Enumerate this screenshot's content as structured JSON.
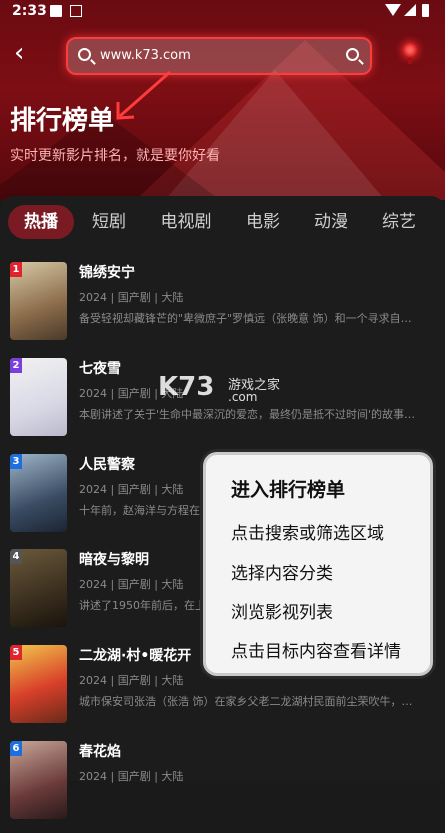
{
  "status_bar": {
    "time": "2:33"
  },
  "search": {
    "url": "www.k73.com"
  },
  "header": {
    "title": "排行榜单",
    "subtitle": "实时更新影片排名，就是要你好看"
  },
  "tabs": [
    "热播",
    "短剧",
    "电视剧",
    "电影",
    "动漫",
    "综艺"
  ],
  "active_tab": "热播",
  "items": [
    {
      "rank": "1",
      "rank_color": "#e0242f",
      "name": "锦绣安宁",
      "meta": "2024 | 国产剧 | 大陆",
      "desc": "备受轻视却藏锋芒的\"卑微庶子\"罗慎远（张晚意 饰）和一个寻求自由…"
    },
    {
      "rank": "2",
      "rank_color": "#7b3fe0",
      "name": "七夜雪",
      "meta": "2024 | 国产剧 | 大陆",
      "desc": "本剧讲述了关于'生命中最深沉的爱恋，最终仍是抵不过时间'的故事。…"
    },
    {
      "rank": "3",
      "rank_color": "#1d6fe0",
      "name": "人民警察",
      "meta": "2024 | 国产剧 | 大陆",
      "desc": "十年前，赵海洋与方程在…"
    },
    {
      "rank": "4",
      "rank_color": "#555555",
      "name": "暗夜与黎明",
      "meta": "2024 | 国产剧 | 大陆",
      "desc": "讲述了1950年前后，在上…"
    },
    {
      "rank": "5",
      "rank_color": "#e0242f",
      "name": "二龙湖·村•暖花开",
      "meta": "2024 | 国产剧 | 大陆",
      "desc": "城市保安司张浩（张浩 饰）在家乡父老二龙湖村民面前尘荣吹牛，为了…"
    },
    {
      "rank": "6",
      "rank_color": "#1d6fe0",
      "name": "春花焰",
      "meta": "2024 | 国产剧 | 大陆",
      "desc": ""
    }
  ],
  "watermark": {
    "brand": "K73",
    "site_name": "游戏之家",
    "domain": ".com"
  },
  "popup": {
    "heading": "进入排行榜单",
    "steps": [
      "点击搜索或筛选区域",
      "选择内容分类",
      "浏览影视列表",
      "点击目标内容查看详情"
    ]
  },
  "colors": {
    "accent": "#e0242f",
    "hero": "#7d0e14",
    "background": "#1c1c1c"
  },
  "icons": [
    "back-icon",
    "search-icon",
    "location-pin-icon"
  ]
}
